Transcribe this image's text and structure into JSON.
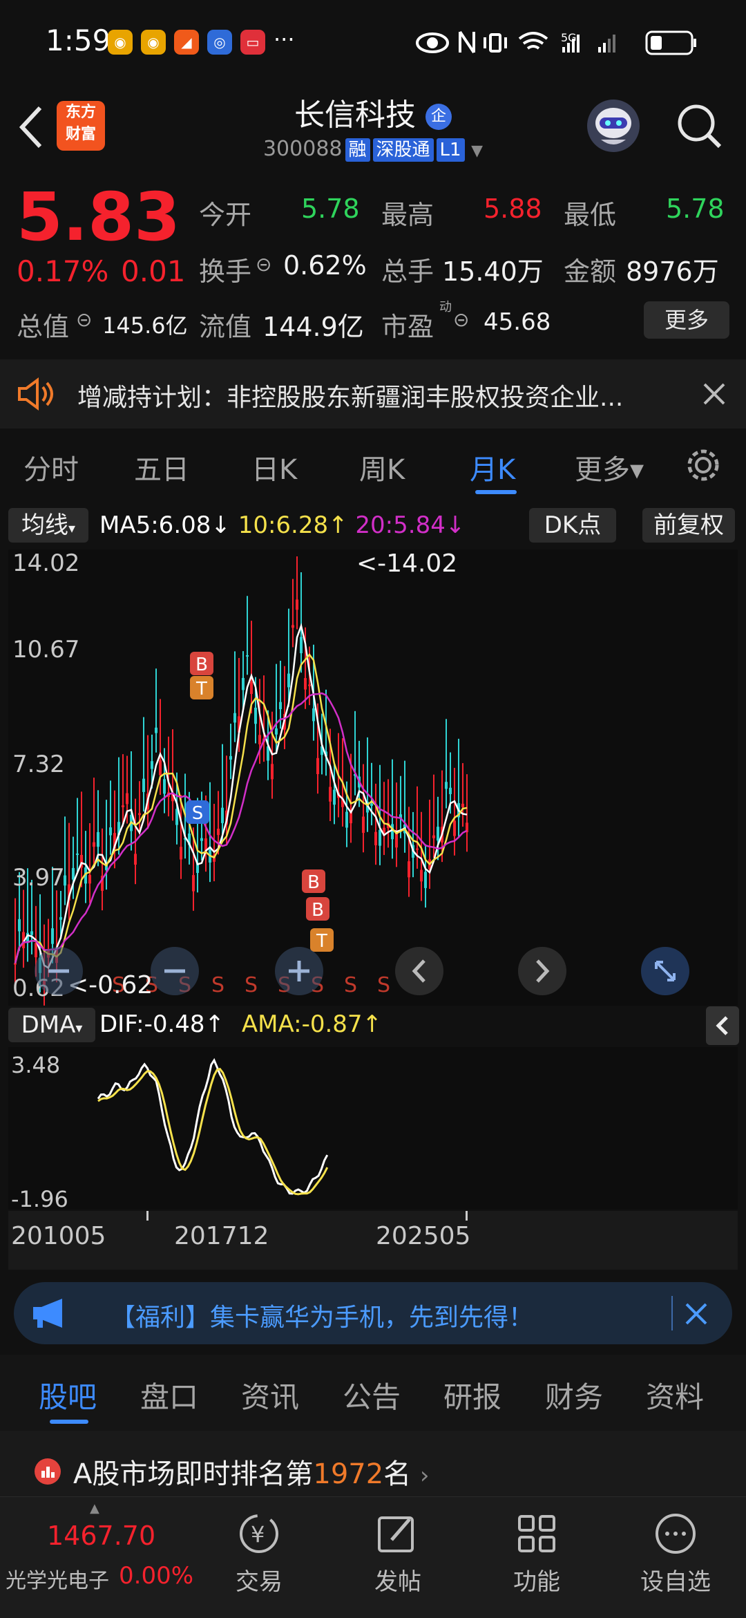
{
  "status_bar": {
    "time": "1:59",
    "more": "···",
    "network": "5G"
  },
  "header": {
    "back_icon": "back-arrow-icon",
    "logo_line1": "东方",
    "logo_line2": "财富",
    "title": "长信科技",
    "verified_badge": "企",
    "code": "300088",
    "tag_rong": "融",
    "tag_sgt": "深股通",
    "tag_level": "L1"
  },
  "quote": {
    "price": "5.83",
    "change_pct": "0.17%",
    "change_abs": "0.01",
    "open_label": "今开",
    "open_value": "5.78",
    "high_label": "最高",
    "high_value": "5.88",
    "low_label": "最低",
    "low_value": "5.78",
    "turnover_label": "换手",
    "turnover_value": "0.62%",
    "volume_label": "总手",
    "volume_value": "15.40万",
    "amount_label": "金额",
    "amount_value": "8976万",
    "mktcap_label": "总值",
    "mktcap_value": "145.6亿",
    "float_label": "流值",
    "float_value": "144.9亿",
    "pe_label": "市盈",
    "pe_sup": "动",
    "pe_value": "45.68",
    "more_label": "更多"
  },
  "notice": {
    "text": "增减持计划：非控股股东新疆润丰股权投资企业..."
  },
  "period_tabs": [
    "分时",
    "五日",
    "日K",
    "周K",
    "月K",
    "更多▾"
  ],
  "active_tab": "月K",
  "chart_header": {
    "indicator": "均线",
    "ma5": "MA5:6.08↓",
    "ma10": "10:6.28↑",
    "ma20": "20:5.84↓",
    "dk_button": "DK点",
    "adjust_button": "前复权"
  },
  "colors": {
    "ma5": "#ffffff",
    "ma10": "#f5e14b",
    "ma20": "#d22fc8",
    "up": "#f5222d",
    "down": "#2fd4d4",
    "accent": "#2f7bf5"
  },
  "main_axis": {
    "labels": [
      "14.02",
      "10.67",
      "7.32",
      "3.97",
      "0.62"
    ],
    "max_annot": "<-14.02",
    "min_annot": "<-0.62"
  },
  "signals": {
    "s": "S",
    "b": "B",
    "t": "T"
  },
  "dma": {
    "label": "DMA",
    "dif": "DIF:-0.48↑",
    "ama": "AMA:-0.87↑",
    "axis_top": "3.48",
    "axis_bottom": "-1.96"
  },
  "x_axis": [
    "201005",
    "201712",
    "202505"
  ],
  "chart_data": {
    "type": "line",
    "x": [
      "201005",
      "201712",
      "202505"
    ],
    "series": [
      {
        "name": "MA5",
        "values": [
          6.08
        ]
      },
      {
        "name": "10",
        "values": [
          6.28
        ]
      },
      {
        "name": "20",
        "values": [
          5.84
        ]
      },
      {
        "name": "DIF",
        "values": [
          -0.48
        ]
      },
      {
        "name": "AMA",
        "values": [
          -0.87
        ]
      }
    ],
    "ylim": [
      0.62,
      14.02
    ],
    "annotations": [
      "<-14.02",
      "<-0.62"
    ]
  },
  "banner": {
    "text": "【福利】集卡赢华为手机，先到先得！"
  },
  "sub_tabs": [
    "股吧",
    "盘口",
    "资讯",
    "公告",
    "研报",
    "财务",
    "资料"
  ],
  "rank": {
    "prefix": "A股市场即时排名第",
    "number": "1972",
    "suffix": "名"
  },
  "sector": {
    "value": "1467.70",
    "name": "光学光电子",
    "pct": "0.00%"
  },
  "bottom_nav": [
    "交易",
    "发帖",
    "功能",
    "设自选"
  ]
}
